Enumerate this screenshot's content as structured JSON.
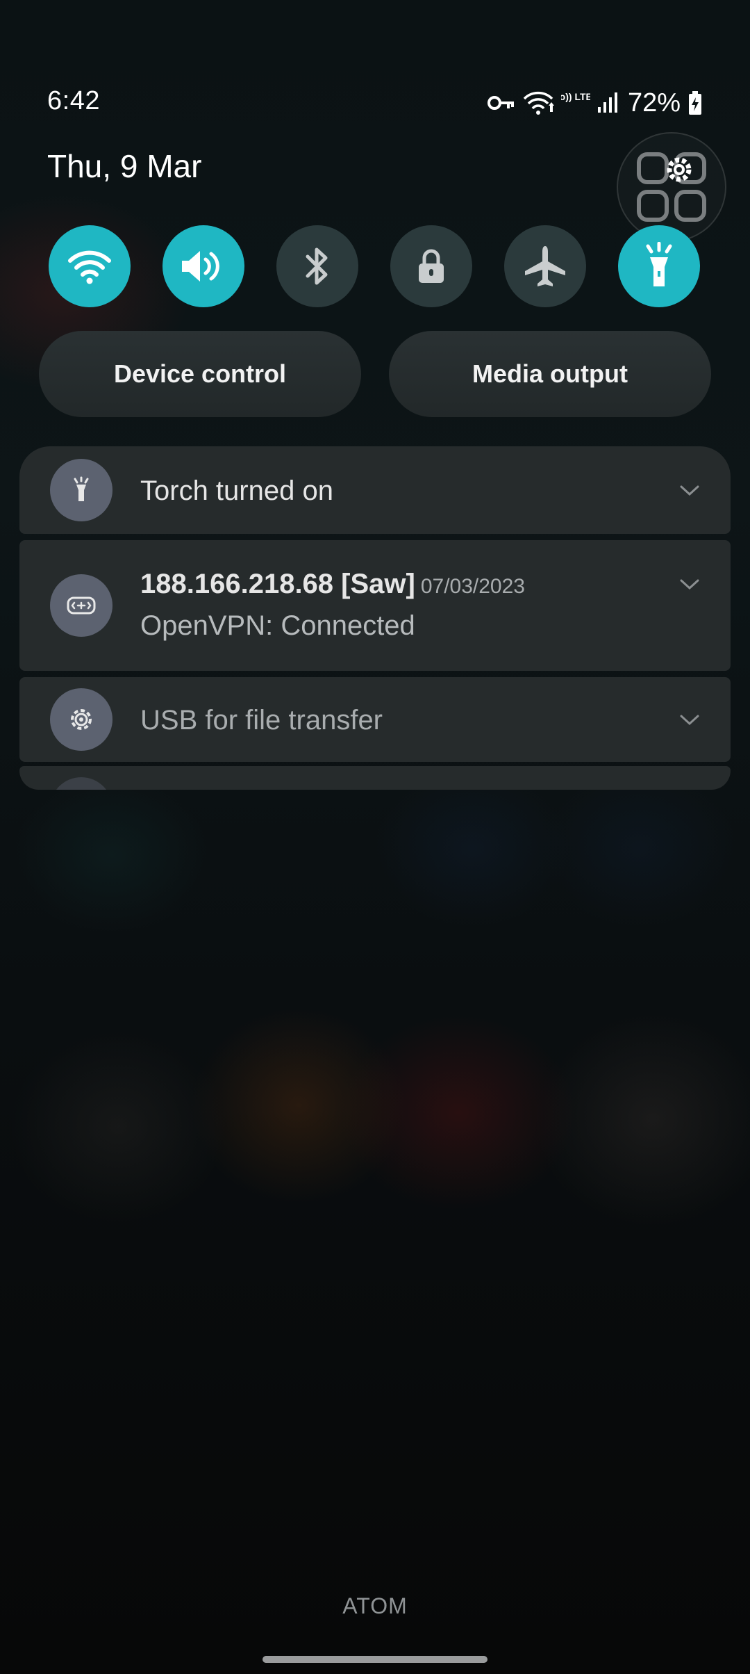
{
  "status_bar": {
    "time": "6:42",
    "network_label": "Vo)) LTE1",
    "battery_percent": "72%"
  },
  "date": "Thu, 9 Mar",
  "quick_settings": {
    "tiles": [
      {
        "name": "wifi",
        "state": "on",
        "icon": "wifi-icon"
      },
      {
        "name": "sound",
        "state": "on",
        "icon": "speaker-icon"
      },
      {
        "name": "bluetooth",
        "state": "off",
        "icon": "bluetooth-icon"
      },
      {
        "name": "lock",
        "state": "off",
        "icon": "lock-icon"
      },
      {
        "name": "airplane",
        "state": "off",
        "icon": "airplane-icon"
      },
      {
        "name": "torch",
        "state": "on",
        "icon": "flashlight-icon"
      }
    ],
    "accent_color": "#1fb7c3",
    "device_control_label": "Device control",
    "media_output_label": "Media output"
  },
  "notifications": [
    {
      "title": "Torch turned on",
      "icon": "flashlight-icon"
    },
    {
      "title": "188.166.218.68 [Saw]",
      "date": "07/03/2023",
      "subtitle": "OpenVPN: Connected",
      "icon": "vpn-icon"
    },
    {
      "title": "USB for file transfer",
      "icon": "usb-settings-icon"
    }
  ],
  "footer": {
    "brand": "ATOM"
  }
}
